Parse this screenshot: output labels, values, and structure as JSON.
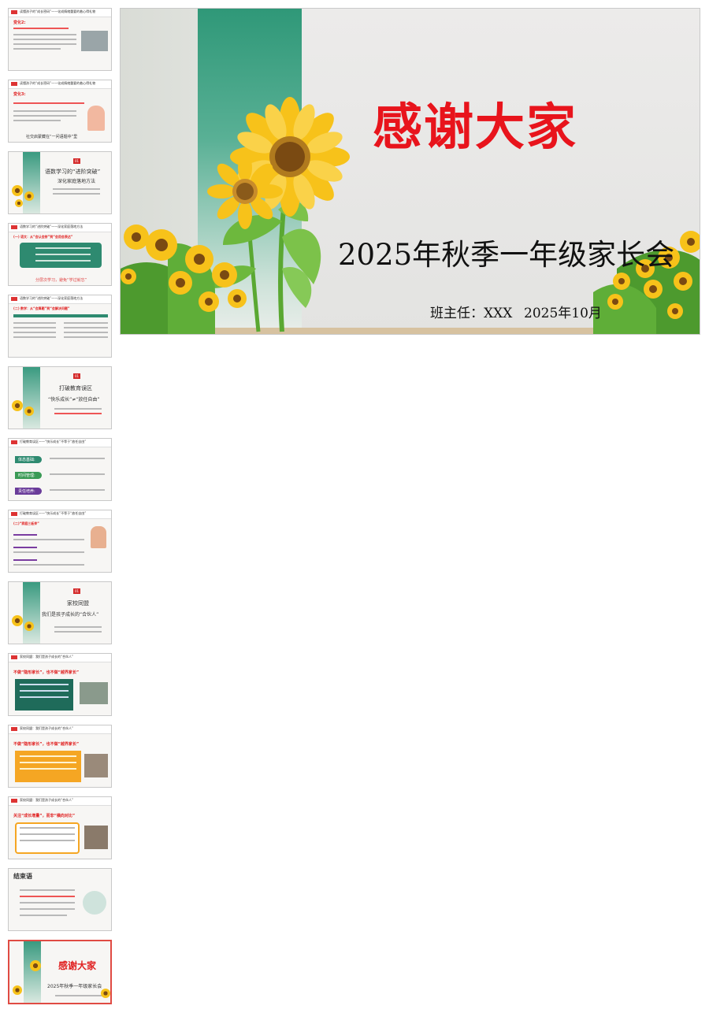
{
  "main_slide": {
    "title": "感谢大家",
    "subtitle": "2025年秋季一年级家长会",
    "teacher": "班主任：XXX",
    "date": "2025年10月"
  },
  "thumbnails": [
    {
      "title": "读懂孩子的“成长密码”——化成情绪重要的着心得礼物",
      "label1": "变化2:",
      "label2": "",
      "text": ""
    },
    {
      "title": "读懂孩子的“成长密码”——化成情绪重要的着心得礼物",
      "label1": "变化3:",
      "label2": "",
      "text": "社交启蒙藏在“一问语题中”里"
    },
    {
      "title": "",
      "label1": "01",
      "label2": "语数学习的“进阶突破”",
      "text": "深化家庭落地方法"
    },
    {
      "title": "语数学习的“进阶突破”——深化家庭落地方法",
      "label1": "(一) 语文：从“会认会拼”到“会用会表达”",
      "label2": "",
      "text": "分层次学习，避免“学过就忘”"
    },
    {
      "title": "语数学习的“进阶突破”——深化家庭落地方法",
      "label1": "(二) 数学：从“会算题”到“会解决问题”",
      "label2": "",
      "text": ""
    },
    {
      "title": "",
      "label1": "01",
      "label2": "打破教育误区",
      "text": "“快乐成长”≠“放任自由”"
    },
    {
      "title": "打破教育误区——“快乐成长”不等于“放任自由”",
      "label1": "体态基础:",
      "label2": "时间管理:",
      "text": "责任培养:"
    },
    {
      "title": "打破教育误区——“快乐成长”不等于“放任自由”",
      "label1": "(二)“家庭三板斧”",
      "label2": "",
      "text": ""
    },
    {
      "title": "",
      "label1": "01",
      "label2": "家校同盟",
      "text": "我们是孩子成长的“合伙人”"
    },
    {
      "title": "家校同盟：我们是孩子成长的“合伙人”",
      "label1": "不做“隐形家长”，也不做“越界家长”",
      "label2": "",
      "text": ""
    },
    {
      "title": "家校同盟：我们是孩子成长的“合伙人”",
      "label1": "不做“隐形家长”，也不做“越界家长”",
      "label2": "",
      "text": ""
    },
    {
      "title": "家校同盟：我们是孩子成长的“合伙人”",
      "label1": "关注“成长增量”，而非“横向对比”",
      "label2": "",
      "text": ""
    },
    {
      "title": "结束语",
      "label1": "",
      "label2": "",
      "text": ""
    },
    {
      "title": "",
      "label1": "感谢大家",
      "label2": "",
      "text": "2025年秋季一年级家长会"
    }
  ],
  "colors": {
    "accent_red": "#e8141c",
    "accent_green": "#2f9878",
    "sunflower": "#f7c21a"
  }
}
